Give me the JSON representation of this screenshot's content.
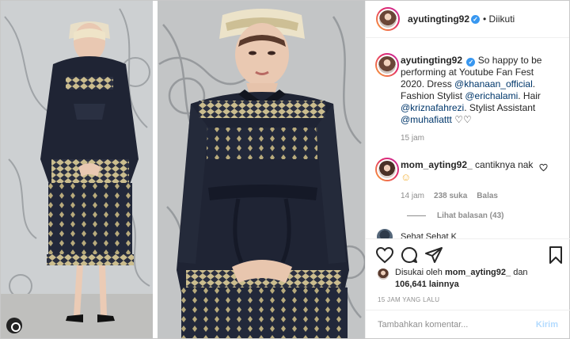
{
  "post": {
    "username": "ayutingting92",
    "follow_state": "• Diikuti",
    "verified": true
  },
  "caption": {
    "username": "ayutingting92",
    "segments": [
      {
        "text": "So happy to be performing at Youtube Fan Fest 2020. Dress ",
        "mention": false
      },
      {
        "text": "@khanaan_official",
        "mention": true
      },
      {
        "text": ". Fashion Stylist ",
        "mention": false
      },
      {
        "text": "@erichalami",
        "mention": true
      },
      {
        "text": ". Hair ",
        "mention": false
      },
      {
        "text": "@kriznafahrezi",
        "mention": true
      },
      {
        "text": ". Stylist Assistant ",
        "mention": false
      },
      {
        "text": "@muhafiattt",
        "mention": true
      },
      {
        "text": " ♡♡",
        "mention": false
      }
    ],
    "time": "15 jam"
  },
  "comment": {
    "username": "mom_ayting92_",
    "text": "cantiknya nak",
    "emoji": "☺",
    "time": "14 jam",
    "likes": "238 suka",
    "reply_label": "Balas",
    "view_replies": "Lihat balasan (43)"
  },
  "partial_comment": {
    "text": "Sehat Sehat K"
  },
  "icons": [
    "heart-icon",
    "comment-icon",
    "share-icon",
    "bookmark-icon",
    "small-heart-icon",
    "verified-icon"
  ],
  "likes": {
    "prefix": "Disukai oleh ",
    "user": "mom_ayting92_",
    "conj": " dan",
    "count": "106,641 lainnya"
  },
  "timestamp": "15 JAM YANG LALU",
  "add_comment": {
    "placeholder": "Tambahkan komentar...",
    "post_label": "Kirim"
  },
  "colors": {
    "link": "#00376b",
    "verified": "#3897f0",
    "muted": "#8e8e8e",
    "post_disabled": "#b3dbff"
  }
}
